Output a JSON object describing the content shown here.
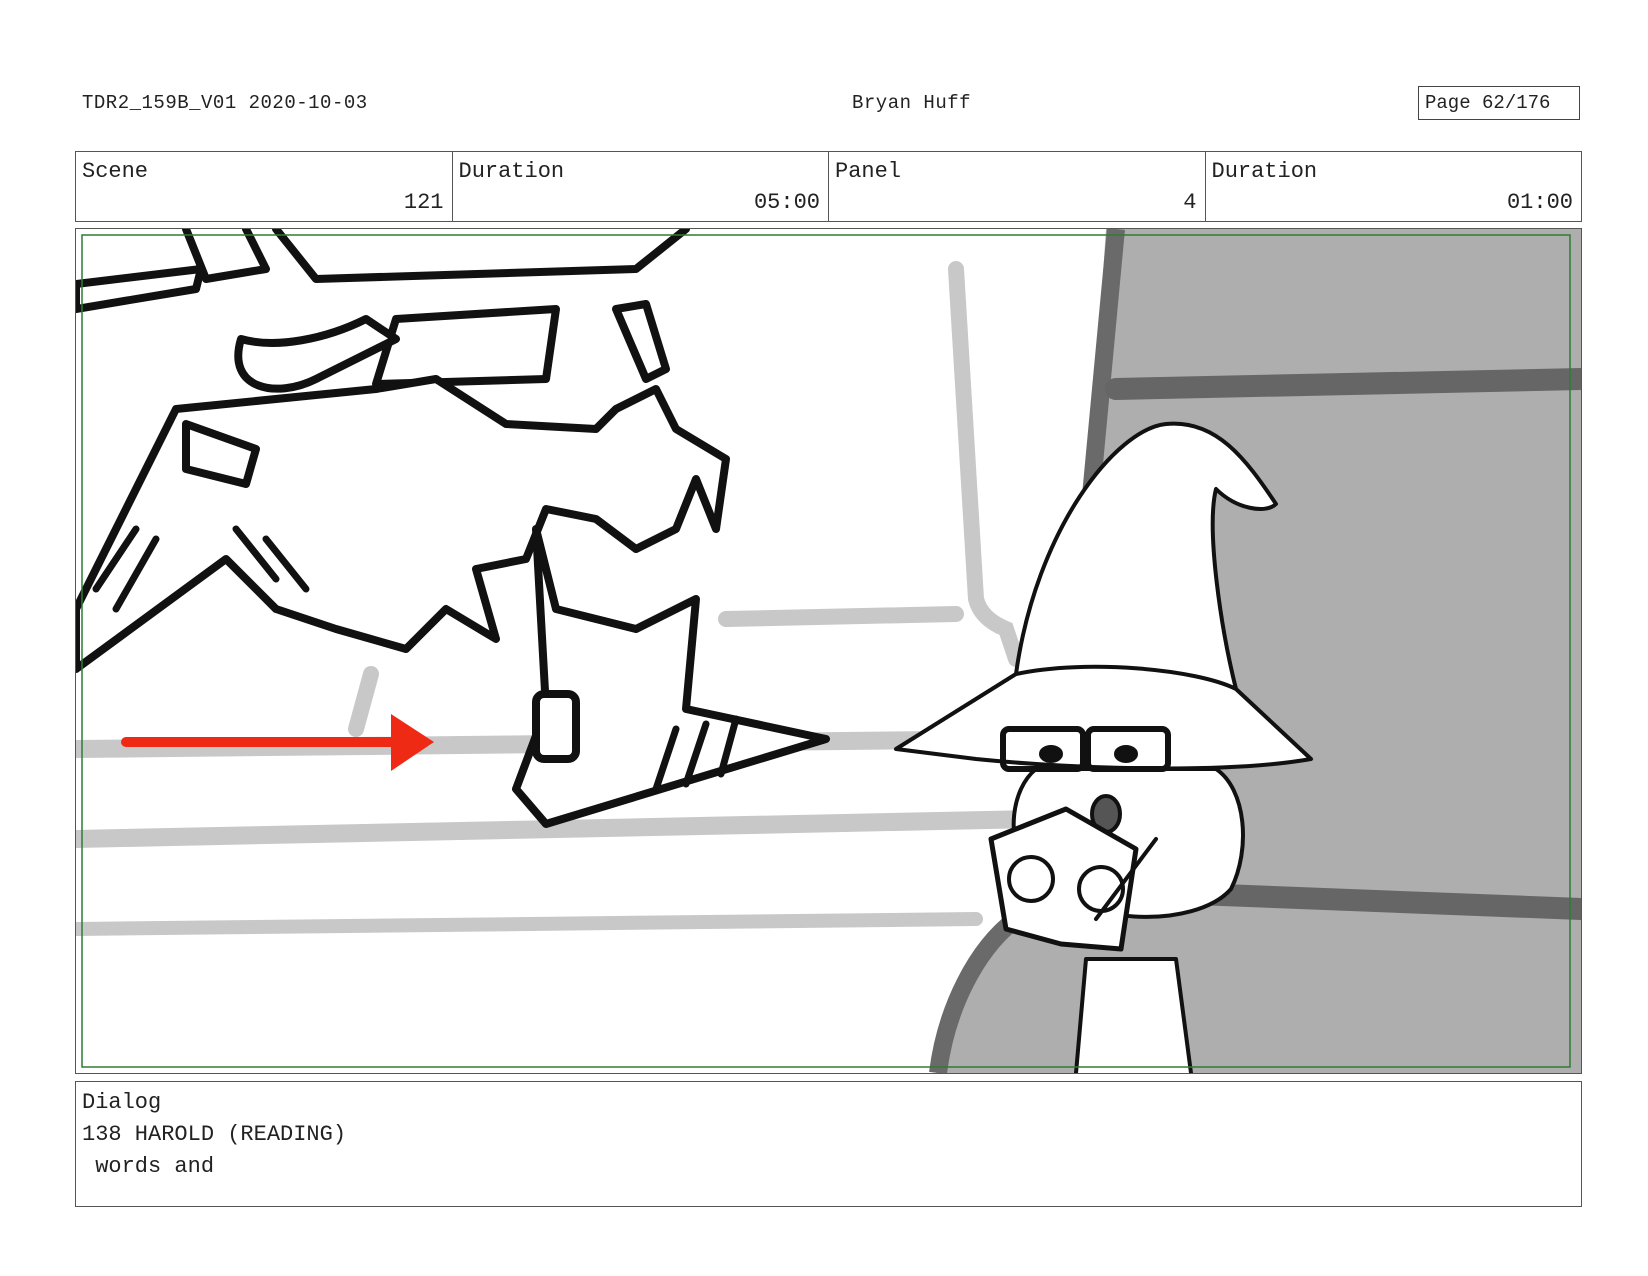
{
  "header": {
    "left": "TDR2_159B_V01  2020-10-03",
    "center": "Bryan Huff",
    "page": "Page  62/176"
  },
  "info": {
    "scene_label": "Scene",
    "scene_value": "121",
    "scene_duration_label": "Duration",
    "scene_duration_value": "05:00",
    "panel_label": "Panel",
    "panel_value": "4",
    "panel_duration_label": "Duration",
    "panel_duration_value": "01:00"
  },
  "panel_art": {
    "description_icon": "storyboard-sketch",
    "arrow_color": "#ee2a14",
    "safe_frame_color": "#2e7d32",
    "shadow_color": "#b0b0b0"
  },
  "dialog": {
    "label": "Dialog",
    "speaker_line": "138 HAROLD (READING)",
    "text_line": " words and"
  }
}
